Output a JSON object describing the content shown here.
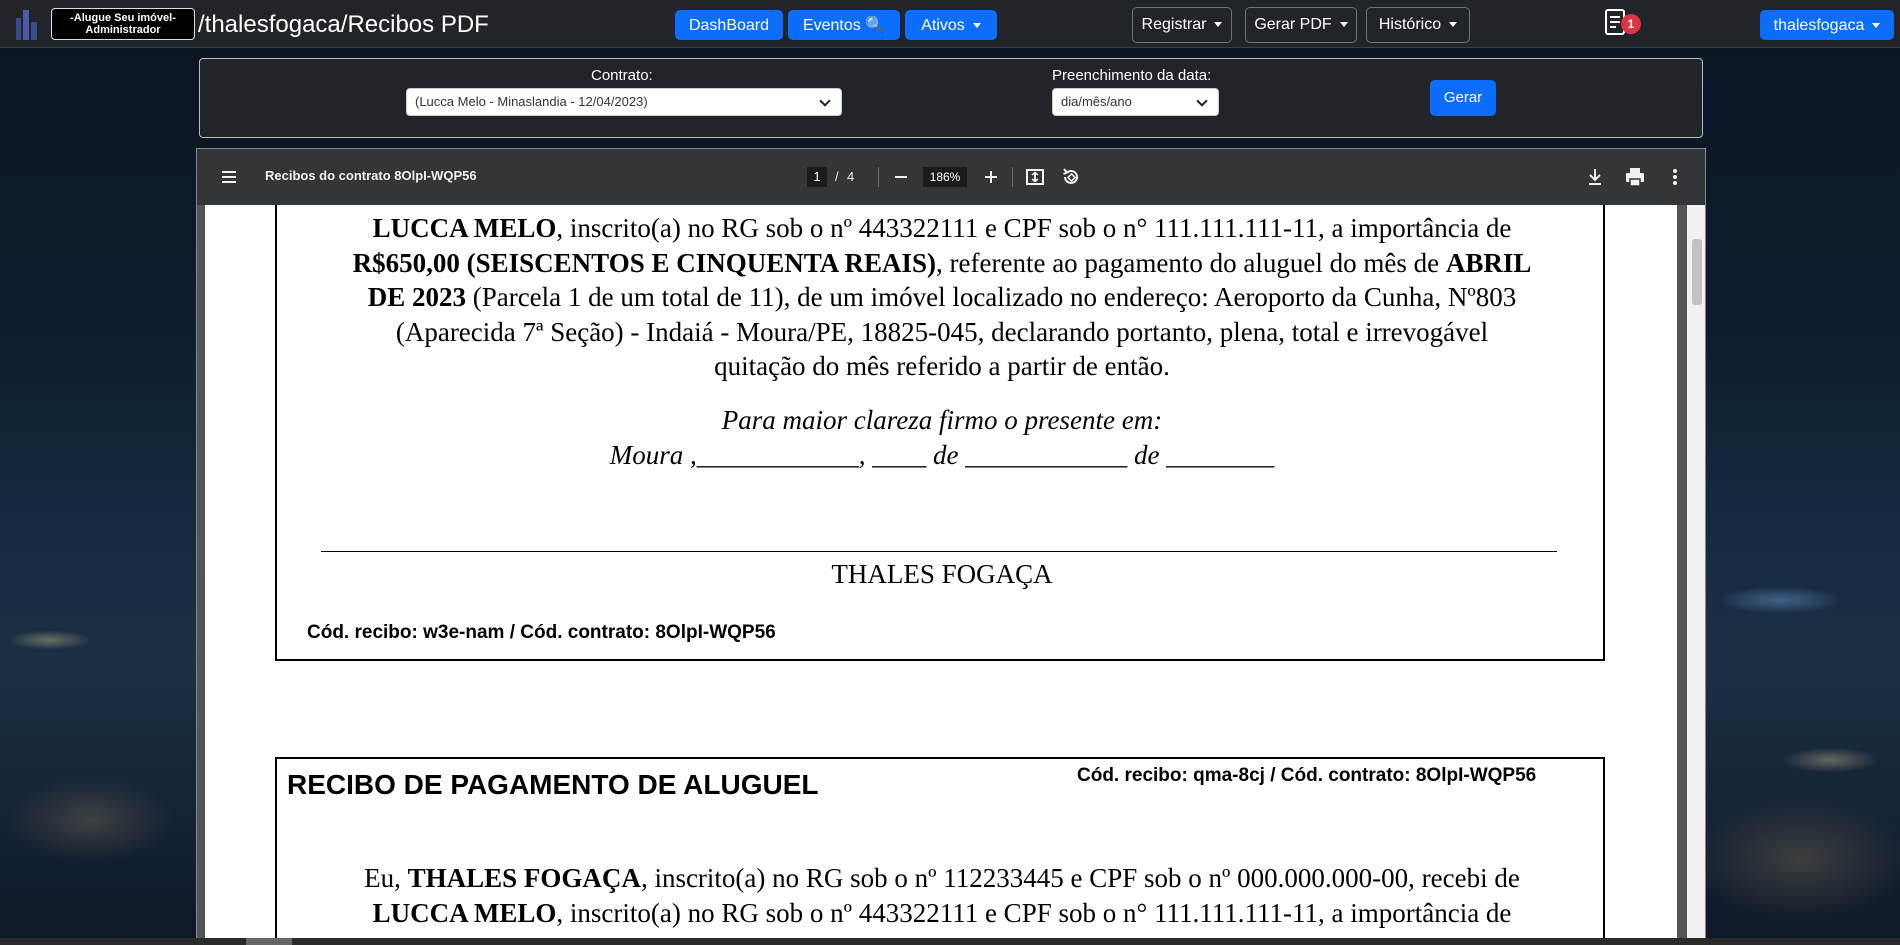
{
  "navbar": {
    "logo_line1": "-Alugue Seu imóvel-",
    "logo_line2": "Administrador",
    "breadcrumb": "/thalesfogaca/Recibos PDF",
    "dashboard": "DashBoard",
    "eventos": "Eventos 🔍",
    "ativos": "Ativos",
    "registrar": "Registrar",
    "gerar_pdf": "Gerar PDF",
    "historico": "Histórico",
    "notification_count": "1",
    "user": "thalesfogaca"
  },
  "filter": {
    "contrato_label": "Contrato:",
    "contrato_value": "(Lucca Melo - Minaslandia - 12/04/2023)",
    "data_label": "Preenchimento da data:",
    "data_value": "dia/mês/ano",
    "gerar": "Gerar"
  },
  "viewer": {
    "title": "Recibos do contrato 8OlpI-WQP56",
    "page_current": "1",
    "page_sep": "/",
    "page_total": "4",
    "zoom": "186%"
  },
  "receipt1": {
    "line1_name": "LUCCA MELO",
    "line1_rest": ", inscrito(a) no RG sob o nº 443322111 e CPF sob o n° 111.111.111-11, a importância de",
    "line2_amount": "R$650,00 (SEISCENTOS E CINQUENTA REAIS)",
    "line2_rest": ", referente ao pagamento do aluguel do mês de ",
    "line2_month": "ABRIL",
    "line3_month": "DE 2023",
    "line3_rest": " (Parcela 1 de um total de 11), de um imóvel localizado no endereço: Aeroporto da Cunha, Nº803",
    "line4": "(Aparecida 7ª Seção) - Indaiá - Moura/PE, 18825-045, declarando portanto, plena, total e irrevogável",
    "line5": "quitação do mês referido a partir de então.",
    "clareza": "Para maior clareza firmo o presente em:",
    "date_line": "Moura ,____________, ____ de ____________ de ________",
    "signer": "THALES FOGAÇA",
    "codes": "Cód. recibo: w3e-nam / Cód. contrato: 8OlpI-WQP56"
  },
  "receipt2": {
    "title": "RECIBO DE PAGAMENTO DE ALUGUEL",
    "codes": "Cód. recibo: qma-8cj / Cód. contrato: 8OlpI-WQP56",
    "line1_pre": "Eu, ",
    "line1_name": "THALES FOGAÇA",
    "line1_rest": ", inscrito(a) no RG sob o nº 112233445 e CPF sob o nº 000.000.000-00, recebi de",
    "line2_name": "LUCCA MELO",
    "line2_rest": ", inscrito(a) no RG sob o nº 443322111 e CPF sob o n° 111.111.111-11, a importância de"
  }
}
